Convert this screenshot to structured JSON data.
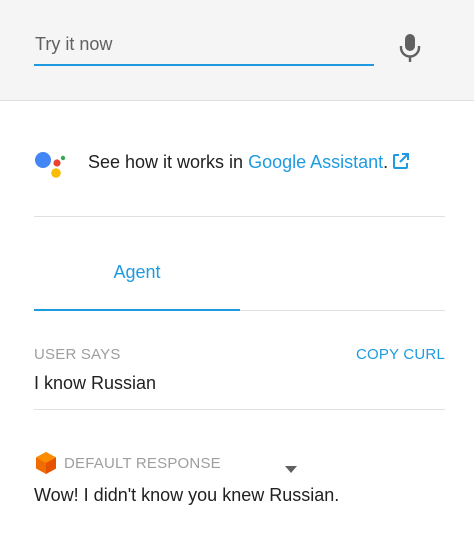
{
  "try_it": {
    "placeholder": "Try it now"
  },
  "assistant": {
    "prefix": "See how it works in ",
    "link": "Google Assistant",
    "suffix": "."
  },
  "tabs": [
    {
      "label": "Agent",
      "active": true
    }
  ],
  "user_says": {
    "label": "USER SAYS",
    "action": "COPY CURL",
    "query": "I know Russian"
  },
  "response": {
    "label": "DEFAULT RESPONSE",
    "text": "Wow! I didn't know you knew Russian."
  },
  "colors": {
    "accent": "#1e9be0",
    "label_gray": "#9e9e9e",
    "dialogflow_orange": "#ef6c00",
    "google_blue": "#4285f4",
    "google_red": "#ea4335",
    "google_yellow": "#fbbc04",
    "google_green": "#34a853"
  },
  "icons": {
    "mic": "microphone-icon",
    "assistant": "google-assistant-logo",
    "external": "external-link-icon",
    "dialogflow": "dialogflow-cube-icon",
    "caret": "caret-down-icon"
  }
}
